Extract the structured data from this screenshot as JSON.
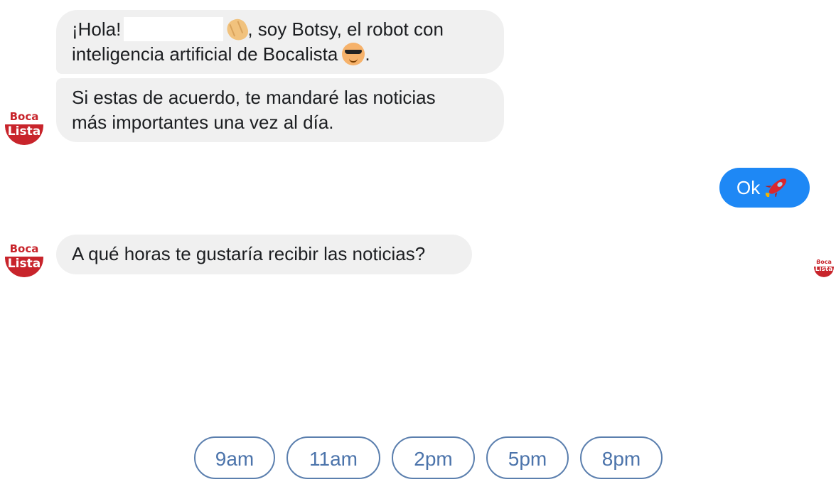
{
  "colors": {
    "bot_bubble": "#f0f0f0",
    "user_bubble": "#1e88f5",
    "quick_reply_border": "#5b7fae",
    "quick_reply_text": "#4c74ab",
    "avatar_red": "#c8242b"
  },
  "bot": {
    "avatar_line1": "Boca",
    "avatar_line2": "Lista"
  },
  "messages": [
    {
      "sender": "bot",
      "greeting": "¡Hola!",
      "wave_icon": "waving-hand-icon",
      "text_after_wave": ", soy Botsy, el robot con",
      "text_line2": "inteligencia artificial de Bocalista",
      "cool_icon": "sunglasses-face-icon",
      "text_end": "."
    },
    {
      "sender": "bot",
      "line1": "Si estas de acuerdo, te mandaré las noticias",
      "line2": "más importantes una vez al día."
    },
    {
      "sender": "user",
      "text": "Ok",
      "icon": "rocket-icon"
    },
    {
      "sender": "bot",
      "text": "A qué horas te gustaría recibir las noticias?"
    }
  ],
  "quick_replies": [
    "9am",
    "11am",
    "2pm",
    "5pm",
    "8pm"
  ]
}
